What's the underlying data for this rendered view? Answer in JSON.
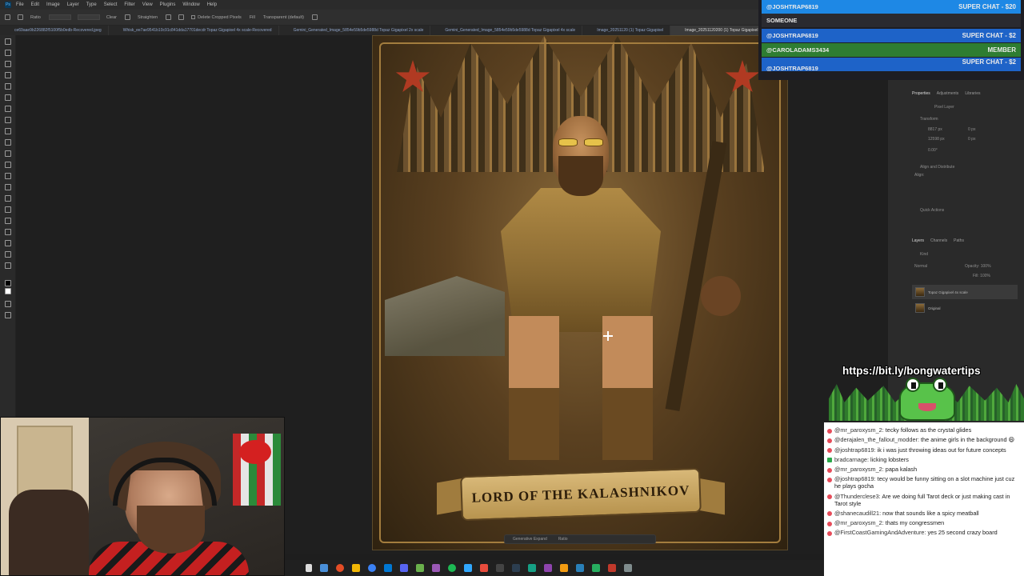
{
  "menubar": {
    "items": [
      "File",
      "Edit",
      "Image",
      "Layer",
      "Type",
      "Select",
      "Filter",
      "View",
      "Plugins",
      "Window",
      "Help"
    ]
  },
  "options": {
    "ratio_label": "Ratio",
    "clear_label": "Clear",
    "straighten_label": "Straighten",
    "delete_cropped_label": "Delete Cropped Pixels",
    "fill_label": "Fill",
    "fill_value": "Transparent (default)"
  },
  "tabs": [
    "ce69aae9b226882f5100f5b0edb-Recovered.jpeg",
    "Whisk_ee7ae9541b10c91c841dda17701decdr Topaz Gigapixel 4x scale-Recovered",
    "Gemini_Generated_Image_5854e59b5de5988d Topaz Gigapixel 2x scale",
    "Gemini_Generated_Image_5854e59b5de5988d Topaz Gigapixel 4x scale",
    "Image_20251120 (1) Topaz Gigapixel",
    "Image_20251120200 (1) Topaz Gigapixel 4x"
  ],
  "artwork": {
    "banner_text": "LORD OF THE KALASHNIKOV"
  },
  "context_bar": {
    "generative_label": "Generative Expand",
    "ratio_label": "Ratio"
  },
  "superchats": [
    {
      "name": "@JOSHTRAP6819",
      "tag": "SUPER CHAT - $20",
      "color": "#1e88e5"
    },
    {
      "name": "SOMEONE",
      "tag": "",
      "color": "#2a2a30"
    },
    {
      "name": "@JOSHTRAP6819",
      "tag": "SUPER CHAT - $2",
      "color": "#1e63c8"
    },
    {
      "name": "@CAROLADAMS3434",
      "tag": "MEMBER",
      "color": "#2e7d32"
    },
    {
      "name": "@JOSHTRAP6819",
      "tag": "SUPER CHAT - $2",
      "color": "#1e63c8"
    }
  ],
  "panels": {
    "top_tabs": [
      "Properties",
      "Adjustments",
      "Libraries"
    ],
    "pixel_layer": "Pixel Layer",
    "transform_label": "Transform",
    "width_value": "8817 px",
    "height_value": "12598 px",
    "x_value": "0 px",
    "y_value": "0 px",
    "angle_value": "0.00°",
    "align_label": "Align and Distribute",
    "align_sub": "Align:",
    "quick_actions": "Quick Actions",
    "layer_tabs": [
      "Layers",
      "Channels",
      "Paths"
    ],
    "kind_label": "Kind",
    "blend_mode": "Normal",
    "opacity_label": "Opacity: 100%",
    "fill_label": "Fill: 100%",
    "layers": [
      "Topaz Gigapixel 4x scale",
      "Original"
    ]
  },
  "frog_banner": {
    "url": "https://bit.ly/bongwatertips"
  },
  "chat": [
    {
      "user": "@mr_paroxysm_2:",
      "text": "tecky follows as the crystal glides",
      "badge": "red"
    },
    {
      "user": "@derajalen_the_fallout_modder:",
      "text": "the anime girls in the background 😄",
      "badge": "red"
    },
    {
      "user": "@joshtrap6819:",
      "text": "ik i was just throwing ideas out for future concepts",
      "badge": "red"
    },
    {
      "user": "bradcarnage:",
      "text": "licking lobsters",
      "badge": "green"
    },
    {
      "user": "@mr_paroxysm_2:",
      "text": "papa kalash",
      "badge": "red"
    },
    {
      "user": "@joshtrap6819:",
      "text": "tecy would be funny sitting on a slot machine just cuz he plays gocha",
      "badge": "red"
    },
    {
      "user": "@Thunderclese3:",
      "text": "Are we doing full Tarot deck or just making cast in Tarot style",
      "badge": "red"
    },
    {
      "user": "@shanecaudill21:",
      "text": "now that sounds like a spicy meatball",
      "badge": "red"
    },
    {
      "user": "@mr_paroxysm_2:",
      "text": "thats my congressmen",
      "badge": "red"
    },
    {
      "user": "@FirstCoastGamingAndAdventure:",
      "text": "yes 25 second crazy board",
      "badge": "red"
    }
  ],
  "colors": {
    "accent": "#1e88e5",
    "member": "#2e7d32"
  }
}
